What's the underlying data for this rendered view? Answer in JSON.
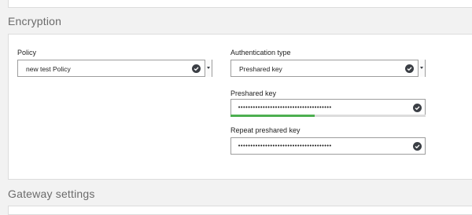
{
  "sections": {
    "encryption_title": "Encryption",
    "gateway_title": "Gateway settings"
  },
  "policy": {
    "label": "Policy",
    "value": "new test Policy",
    "status_icon": "check-circle-icon",
    "dropdown_icon": "chevron-down-icon"
  },
  "auth": {
    "label": "Authentication type",
    "value": "Preshared key",
    "status_icon": "check-circle-icon",
    "dropdown_icon": "chevron-down-icon"
  },
  "preshared": {
    "label": "Preshared key",
    "value": "••••••••••••••••••••••••••••••••••••••",
    "status_icon": "check-circle-icon",
    "strength_fraction": 0.43,
    "strength_color": "#4caf50"
  },
  "repeat": {
    "label": "Repeat preshared key",
    "value": "••••••••••••••••••••••••••••••••••••••",
    "status_icon": "check-circle-icon"
  }
}
